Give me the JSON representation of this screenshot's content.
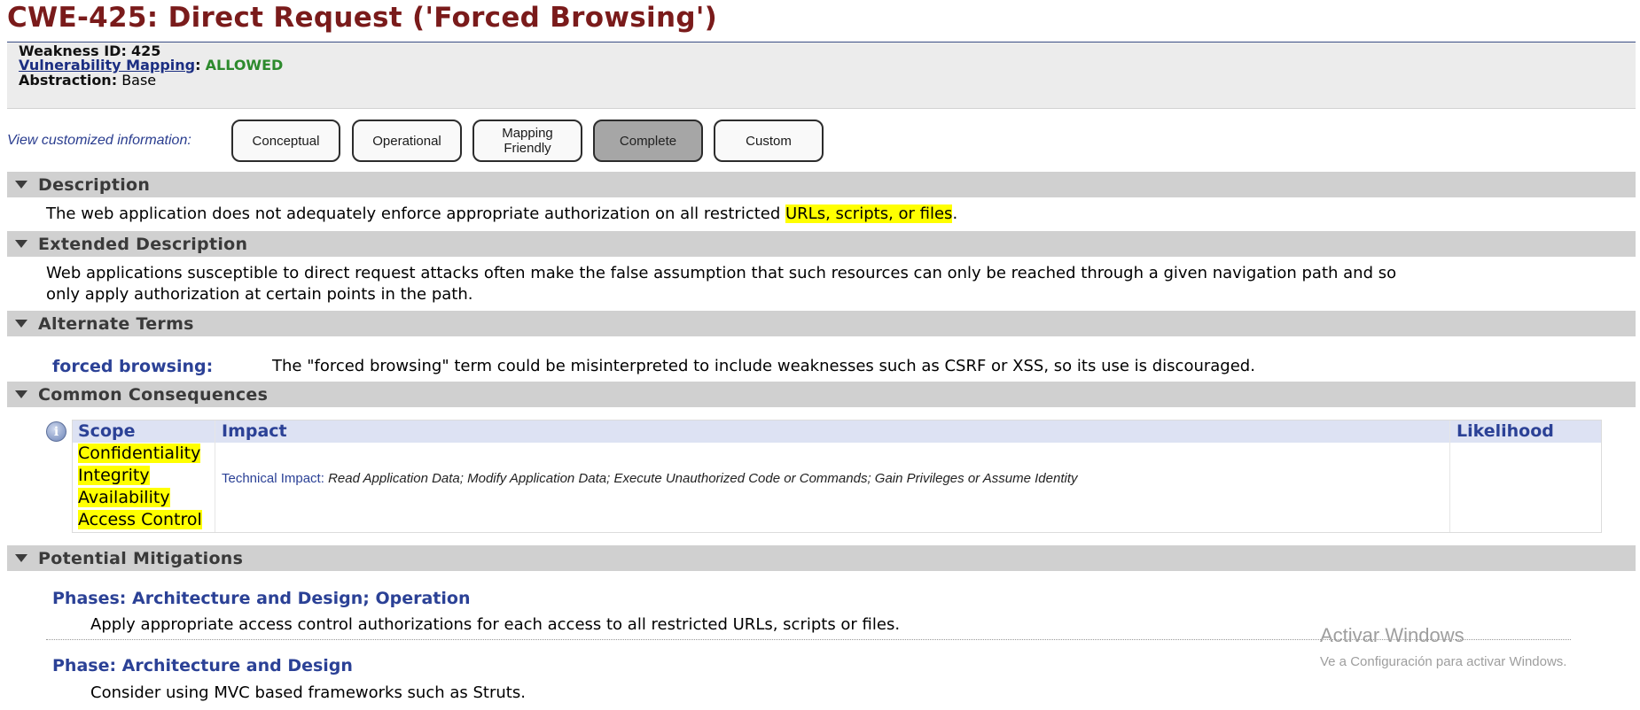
{
  "page": {
    "title": "CWE-425: Direct Request ('Forced Browsing')"
  },
  "meta": {
    "weakness_id_label": "Weakness ID:",
    "weakness_id": "425",
    "mapping_link": "Vulnerability Mapping",
    "mapping_sep": ":",
    "mapping_value": "ALLOWED",
    "abstraction_label": "Abstraction:",
    "abstraction_value": "Base"
  },
  "view": {
    "label": "View customized information:",
    "buttons": [
      "Conceptual",
      "Operational",
      "Mapping Friendly",
      "Complete",
      "Custom"
    ],
    "active": "Complete"
  },
  "description": {
    "heading": "Description",
    "text_before": "The web application does not adequately enforce appropriate authorization on all restricted ",
    "text_highlight": "URLs, scripts, or files",
    "text_after": "."
  },
  "extended": {
    "heading": "Extended Description",
    "line1": "Web applications susceptible to direct request attacks often make the false assumption that such resources can only be reached through a given navigation path and so",
    "line2": "only apply authorization at certain points in the path."
  },
  "alternate": {
    "heading": "Alternate Terms",
    "term": "forced browsing:",
    "desc": "The \"forced browsing\" term could be misinterpreted to include weaknesses such as CSRF or XSS, so its use is discouraged."
  },
  "consequences": {
    "heading": "Common Consequences",
    "info_glyph": "i",
    "col_scope": "Scope",
    "col_impact": "Impact",
    "col_likelihood": "Likelihood",
    "scopes": [
      "Confidentiality",
      "Integrity",
      "Availability",
      "Access Control"
    ],
    "impact_label": "Technical Impact:",
    "impact_value": "Read Application Data; Modify Application Data; Execute Unauthorized Code or Commands; Gain Privileges or Assume Identity",
    "likelihood": ""
  },
  "mitigations": {
    "heading": "Potential Mitigations",
    "items": [
      {
        "phase": "Phases: Architecture and Design; Operation",
        "text": "Apply appropriate access control authorizations for each access to all restricted URLs, scripts or files."
      },
      {
        "phase": "Phase: Architecture and Design",
        "text": "Consider using MVC based frameworks such as Struts."
      }
    ]
  },
  "watermark": {
    "title": "Activar Windows",
    "subtitle": "Ve a Configuración para activar Windows."
  },
  "colors": {
    "title": "#7a1b1b",
    "link": "#2b4196",
    "allowed": "#2d8a2d",
    "section_bar": "#d0d0d0",
    "highlight": "#ffff00"
  },
  "icons": {
    "section_toggle": "triangle-down-icon",
    "info": "info-icon"
  }
}
